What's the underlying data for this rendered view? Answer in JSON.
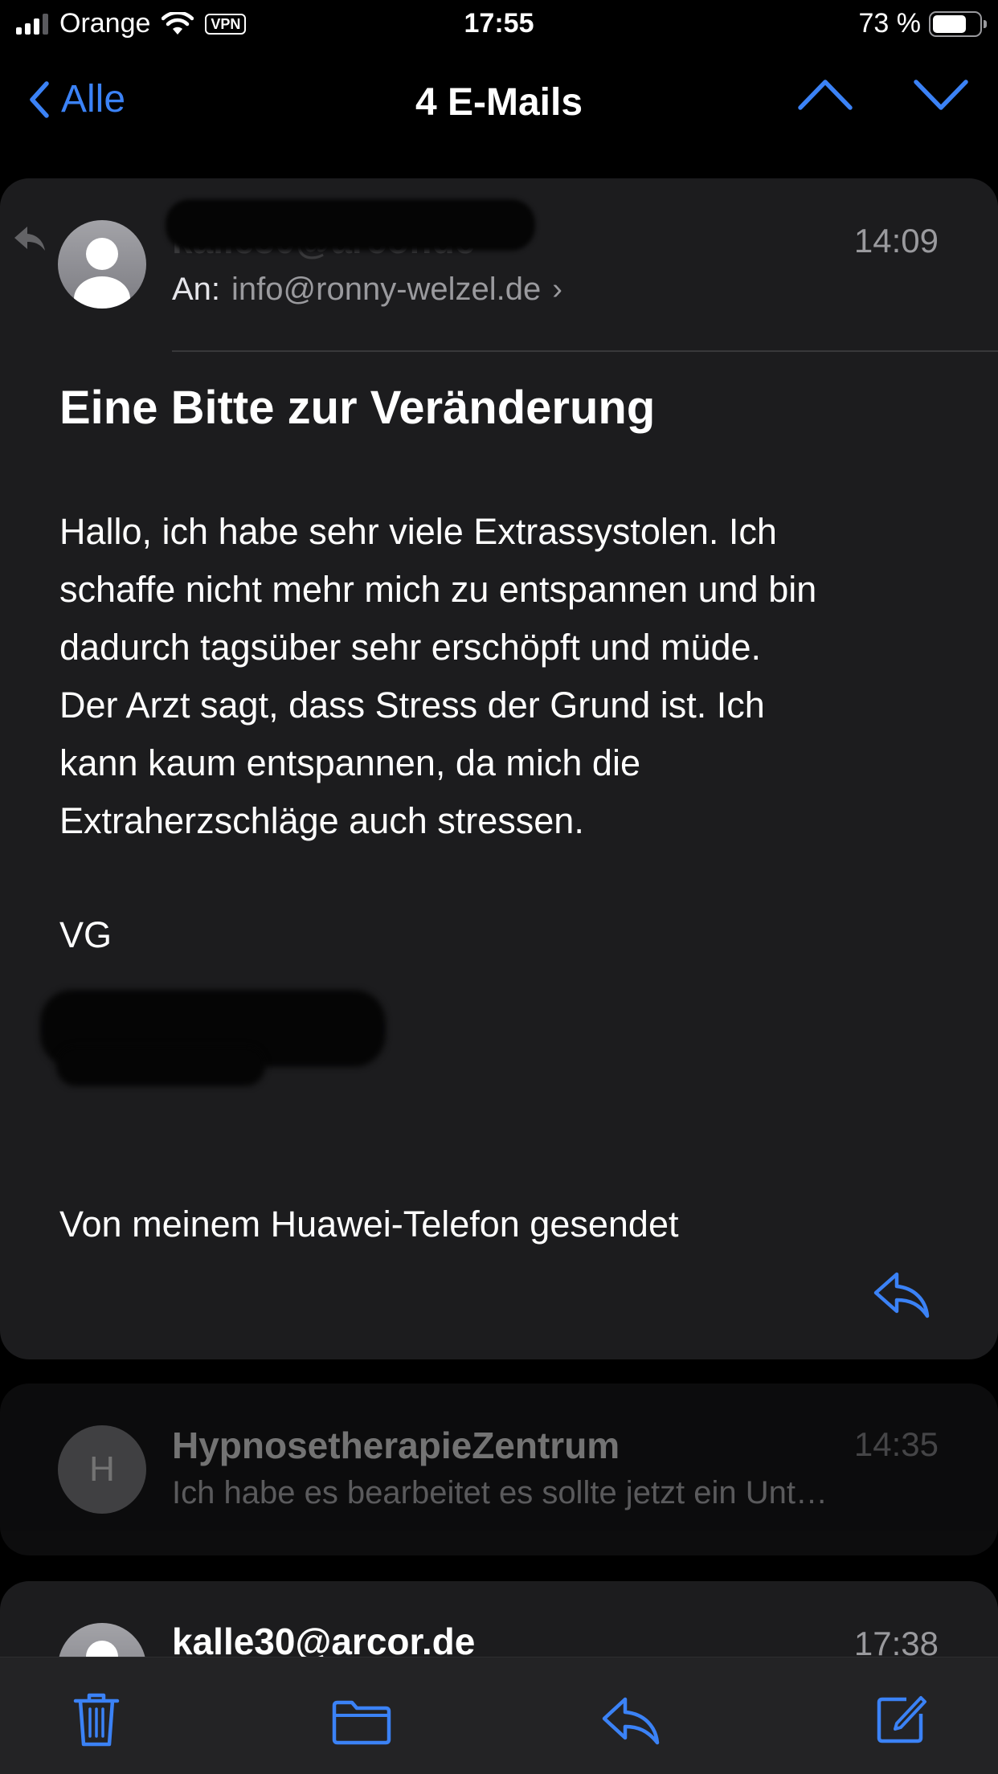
{
  "status_bar": {
    "carrier": "Orange",
    "vpn": "VPN",
    "time": "17:55",
    "battery": "73 %",
    "battery_level": 0.73
  },
  "nav": {
    "back_label": "Alle",
    "title": "4 E-Mails"
  },
  "thread": {
    "open_message": {
      "sender": "kalle30@arcor.de",
      "time": "14:09",
      "to_label": "An:",
      "to_address": "info@ronny-welzel.de",
      "subject": "Eine Bitte zur Veränderung",
      "body_lines": [
        "Hallo, ich habe sehr viele Extrassystolen. Ich",
        "schaffe nicht mehr mich zu entspannen und bin",
        "dadurch tagsüber sehr erschöpft und müde.",
        "Der Arzt sagt, dass Stress der Grund ist. Ich",
        "kann kaum entspannen, da mich die",
        "Extraherzschläge auch stressen."
      ],
      "greeting": "VG",
      "signature": "Von meinem Huawei-Telefon gesendet"
    },
    "collapsed": [
      {
        "avatar_letter": "H",
        "sender": "HypnosetherapieZentrum",
        "time": "14:35",
        "preview": "Ich habe es bearbeitet es sollte jetzt ein Unt…"
      },
      {
        "sender": "kalle30@arcor.de",
        "time": "17:38"
      }
    ]
  },
  "colors": {
    "accent": "#3b82f6",
    "card": "#1c1c1e",
    "background": "#000000"
  },
  "toolbar_icons": [
    "trash-icon",
    "folder-icon",
    "reply-icon",
    "compose-icon"
  ]
}
